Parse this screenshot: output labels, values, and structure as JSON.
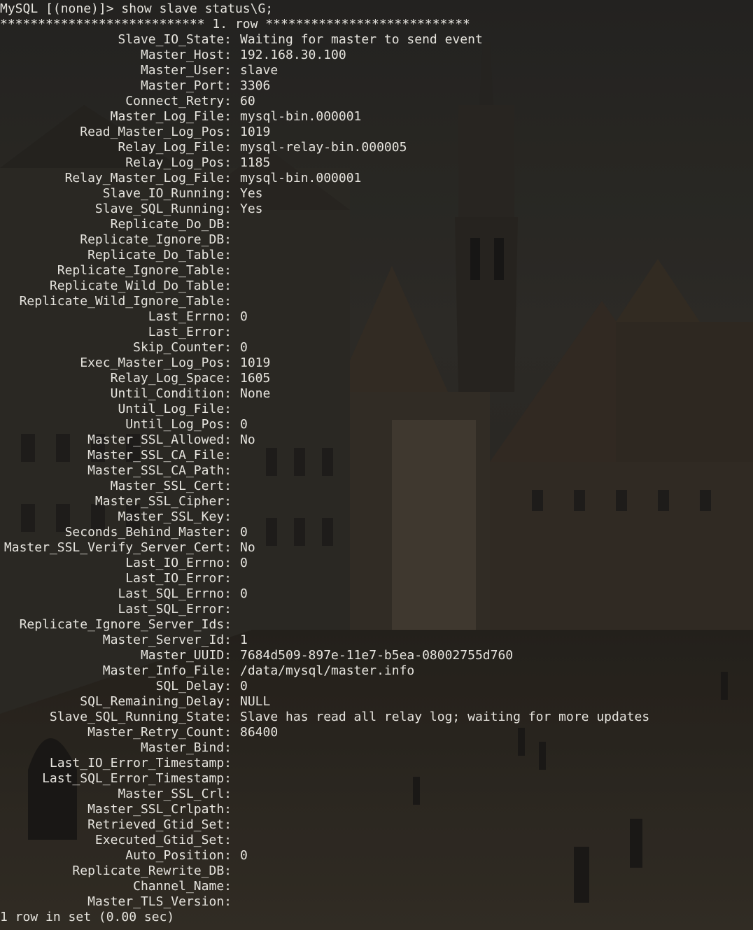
{
  "terminal": {
    "prompt": "MySQL [(none)]> show slave status\\G;",
    "row_header": "*************************** 1. row ***************************",
    "footer": "1 row in set (0.00 sec)",
    "fields": [
      {
        "name": "Slave_IO_State:",
        "value": "Waiting for master to send event"
      },
      {
        "name": "Master_Host:",
        "value": "192.168.30.100"
      },
      {
        "name": "Master_User:",
        "value": "slave"
      },
      {
        "name": "Master_Port:",
        "value": "3306"
      },
      {
        "name": "Connect_Retry:",
        "value": "60"
      },
      {
        "name": "Master_Log_File:",
        "value": "mysql-bin.000001"
      },
      {
        "name": "Read_Master_Log_Pos:",
        "value": "1019"
      },
      {
        "name": "Relay_Log_File:",
        "value": "mysql-relay-bin.000005"
      },
      {
        "name": "Relay_Log_Pos:",
        "value": "1185"
      },
      {
        "name": "Relay_Master_Log_File:",
        "value": "mysql-bin.000001"
      },
      {
        "name": "Slave_IO_Running:",
        "value": "Yes"
      },
      {
        "name": "Slave_SQL_Running:",
        "value": "Yes"
      },
      {
        "name": "Replicate_Do_DB:",
        "value": ""
      },
      {
        "name": "Replicate_Ignore_DB:",
        "value": ""
      },
      {
        "name": "Replicate_Do_Table:",
        "value": ""
      },
      {
        "name": "Replicate_Ignore_Table:",
        "value": ""
      },
      {
        "name": "Replicate_Wild_Do_Table:",
        "value": ""
      },
      {
        "name": "Replicate_Wild_Ignore_Table:",
        "value": ""
      },
      {
        "name": "Last_Errno:",
        "value": "0"
      },
      {
        "name": "Last_Error:",
        "value": ""
      },
      {
        "name": "Skip_Counter:",
        "value": "0"
      },
      {
        "name": "Exec_Master_Log_Pos:",
        "value": "1019"
      },
      {
        "name": "Relay_Log_Space:",
        "value": "1605"
      },
      {
        "name": "Until_Condition:",
        "value": "None"
      },
      {
        "name": "Until_Log_File:",
        "value": ""
      },
      {
        "name": "Until_Log_Pos:",
        "value": "0"
      },
      {
        "name": "Master_SSL_Allowed:",
        "value": "No"
      },
      {
        "name": "Master_SSL_CA_File:",
        "value": ""
      },
      {
        "name": "Master_SSL_CA_Path:",
        "value": ""
      },
      {
        "name": "Master_SSL_Cert:",
        "value": ""
      },
      {
        "name": "Master_SSL_Cipher:",
        "value": ""
      },
      {
        "name": "Master_SSL_Key:",
        "value": ""
      },
      {
        "name": "Seconds_Behind_Master:",
        "value": "0"
      },
      {
        "name": "Master_SSL_Verify_Server_Cert:",
        "value": "No"
      },
      {
        "name": "Last_IO_Errno:",
        "value": "0"
      },
      {
        "name": "Last_IO_Error:",
        "value": ""
      },
      {
        "name": "Last_SQL_Errno:",
        "value": "0"
      },
      {
        "name": "Last_SQL_Error:",
        "value": ""
      },
      {
        "name": "Replicate_Ignore_Server_Ids:",
        "value": ""
      },
      {
        "name": "Master_Server_Id:",
        "value": "1"
      },
      {
        "name": "Master_UUID:",
        "value": "7684d509-897e-11e7-b5ea-08002755d760"
      },
      {
        "name": "Master_Info_File:",
        "value": "/data/mysql/master.info"
      },
      {
        "name": "SQL_Delay:",
        "value": "0"
      },
      {
        "name": "SQL_Remaining_Delay:",
        "value": "NULL"
      },
      {
        "name": "Slave_SQL_Running_State:",
        "value": "Slave has read all relay log; waiting for more updates"
      },
      {
        "name": "Master_Retry_Count:",
        "value": "86400"
      },
      {
        "name": "Master_Bind:",
        "value": ""
      },
      {
        "name": "Last_IO_Error_Timestamp:",
        "value": ""
      },
      {
        "name": "Last_SQL_Error_Timestamp:",
        "value": ""
      },
      {
        "name": "Master_SSL_Crl:",
        "value": ""
      },
      {
        "name": "Master_SSL_Crlpath:",
        "value": ""
      },
      {
        "name": "Retrieved_Gtid_Set:",
        "value": ""
      },
      {
        "name": "Executed_Gtid_Set:",
        "value": ""
      },
      {
        "name": "Auto_Position:",
        "value": "0"
      },
      {
        "name": "Replicate_Rewrite_DB:",
        "value": ""
      },
      {
        "name": "Channel_Name:",
        "value": ""
      },
      {
        "name": "Master_TLS_Version:",
        "value": ""
      }
    ]
  },
  "colors": {
    "text": "#e6e4de",
    "background": "#1e1d1b"
  },
  "background_image": "painted-old-town-square-with-church-tower"
}
